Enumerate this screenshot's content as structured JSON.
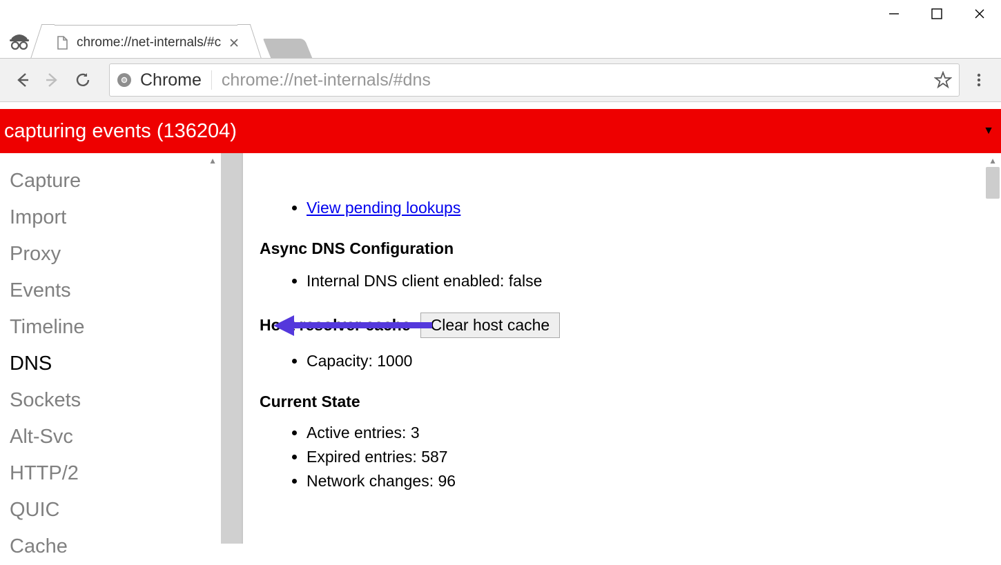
{
  "window": {
    "tab_title": "chrome://net-internals/#c"
  },
  "toolbar": {
    "source_label": "Chrome",
    "url": "chrome://net-internals/#dns"
  },
  "banner": {
    "text": "capturing events (136204)"
  },
  "sidebar": {
    "items": [
      {
        "label": "Capture",
        "active": false
      },
      {
        "label": "Import",
        "active": false
      },
      {
        "label": "Proxy",
        "active": false
      },
      {
        "label": "Events",
        "active": false
      },
      {
        "label": "Timeline",
        "active": false
      },
      {
        "label": "DNS",
        "active": true
      },
      {
        "label": "Sockets",
        "active": false
      },
      {
        "label": "Alt-Svc",
        "active": false
      },
      {
        "label": "HTTP/2",
        "active": false
      },
      {
        "label": "QUIC",
        "active": false
      },
      {
        "label": "Cache",
        "active": false
      }
    ]
  },
  "main": {
    "pending_link": "View pending lookups",
    "async_title": "Async DNS Configuration",
    "async_item": "Internal DNS client enabled: false",
    "cache_title": "Host resolver cache",
    "clear_button": "Clear host cache",
    "capacity_label": "Capacity: 1000",
    "state_title": "Current State",
    "state": {
      "active": "Active entries: 3",
      "expired": "Expired entries: 587",
      "network": "Network changes: 96"
    }
  }
}
